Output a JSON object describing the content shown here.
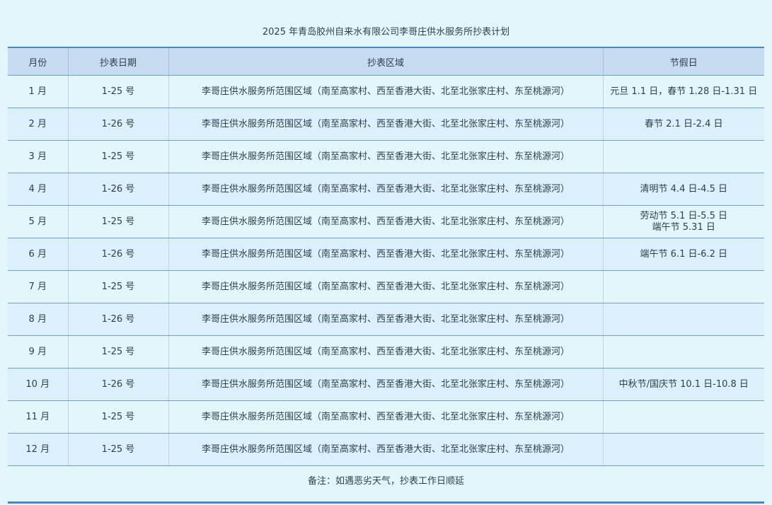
{
  "title": "2025 年青岛胶州自来水有限公司李哥庄供水服务所抄表计划",
  "table": {
    "headers": [
      "月份",
      "抄表日期",
      "抄表区域",
      "节假日"
    ],
    "rows": [
      {
        "month": "1 月",
        "date": "1-25 号",
        "area": "李哥庄供水服务所范围区域（南至高家村、西至香港大街、北至北张家庄村、东至桃源河）",
        "holiday": [
          "元旦 1.1 日，春节 1.28 日-1.31 日"
        ]
      },
      {
        "month": "2 月",
        "date": "1-26 号",
        "area": "李哥庄供水服务所范围区域（南至高家村、西至香港大街、北至北张家庄村、东至桃源河）",
        "holiday": [
          "春节 2.1 日-2.4 日"
        ]
      },
      {
        "month": "3 月",
        "date": "1-25 号",
        "area": "李哥庄供水服务所范围区域（南至高家村、西至香港大街、北至北张家庄村、东至桃源河）",
        "holiday": []
      },
      {
        "month": "4 月",
        "date": "1-26 号",
        "area": "李哥庄供水服务所范围区域（南至高家村、西至香港大街、北至北张家庄村、东至桃源河）",
        "holiday": [
          "清明节 4.4 日-4.5 日"
        ]
      },
      {
        "month": "5 月",
        "date": "1-25 号",
        "area": "李哥庄供水服务所范围区域（南至高家村、西至香港大街、北至北张家庄村、东至桃源河）",
        "holiday": [
          "劳动节 5.1 日-5.5 日",
          "端午节 5.31 日"
        ]
      },
      {
        "month": "6 月",
        "date": "1-26 号",
        "area": "李哥庄供水服务所范围区域（南至高家村、西至香港大街、北至北张家庄村、东至桃源河）",
        "holiday": [
          "端午节 6.1 日-6.2 日"
        ]
      },
      {
        "month": "7 月",
        "date": "1-25 号",
        "area": "李哥庄供水服务所范围区域（南至高家村、西至香港大街、北至北张家庄村、东至桃源河）",
        "holiday": []
      },
      {
        "month": "8 月",
        "date": "1-26 号",
        "area": "李哥庄供水服务所范围区域（南至高家村、西至香港大街、北至北张家庄村、东至桃源河）",
        "holiday": []
      },
      {
        "month": "9 月",
        "date": "1-25 号",
        "area": "李哥庄供水服务所范围区域（南至高家村、西至香港大街、北至北张家庄村、东至桃源河）",
        "holiday": []
      },
      {
        "month": "10 月",
        "date": "1-26 号",
        "area": "李哥庄供水服务所范围区域（南至高家村、西至香港大街、北至北张家庄村、东至桃源河）",
        "holiday": [
          "中秋节/国庆节 10.1 日-10.8 日"
        ]
      },
      {
        "month": "11 月",
        "date": "1-25 号",
        "area": "李哥庄供水服务所范围区域（南至高家村、西至香港大街、北至北张家庄村、东至桃源河）",
        "holiday": []
      },
      {
        "month": "12 月",
        "date": "1-25 号",
        "area": "李哥庄供水服务所范围区域（南至高家村、西至香港大街、北至北张家庄村、东至桃源河）",
        "holiday": []
      }
    ]
  },
  "note": "备注：如遇恶劣天气，抄表工作日顺延",
  "colors": {
    "background": "#e3f6fc",
    "header_background": "#c7dcf1",
    "rule": "#4a86c5",
    "text": "#2e3e4e"
  }
}
